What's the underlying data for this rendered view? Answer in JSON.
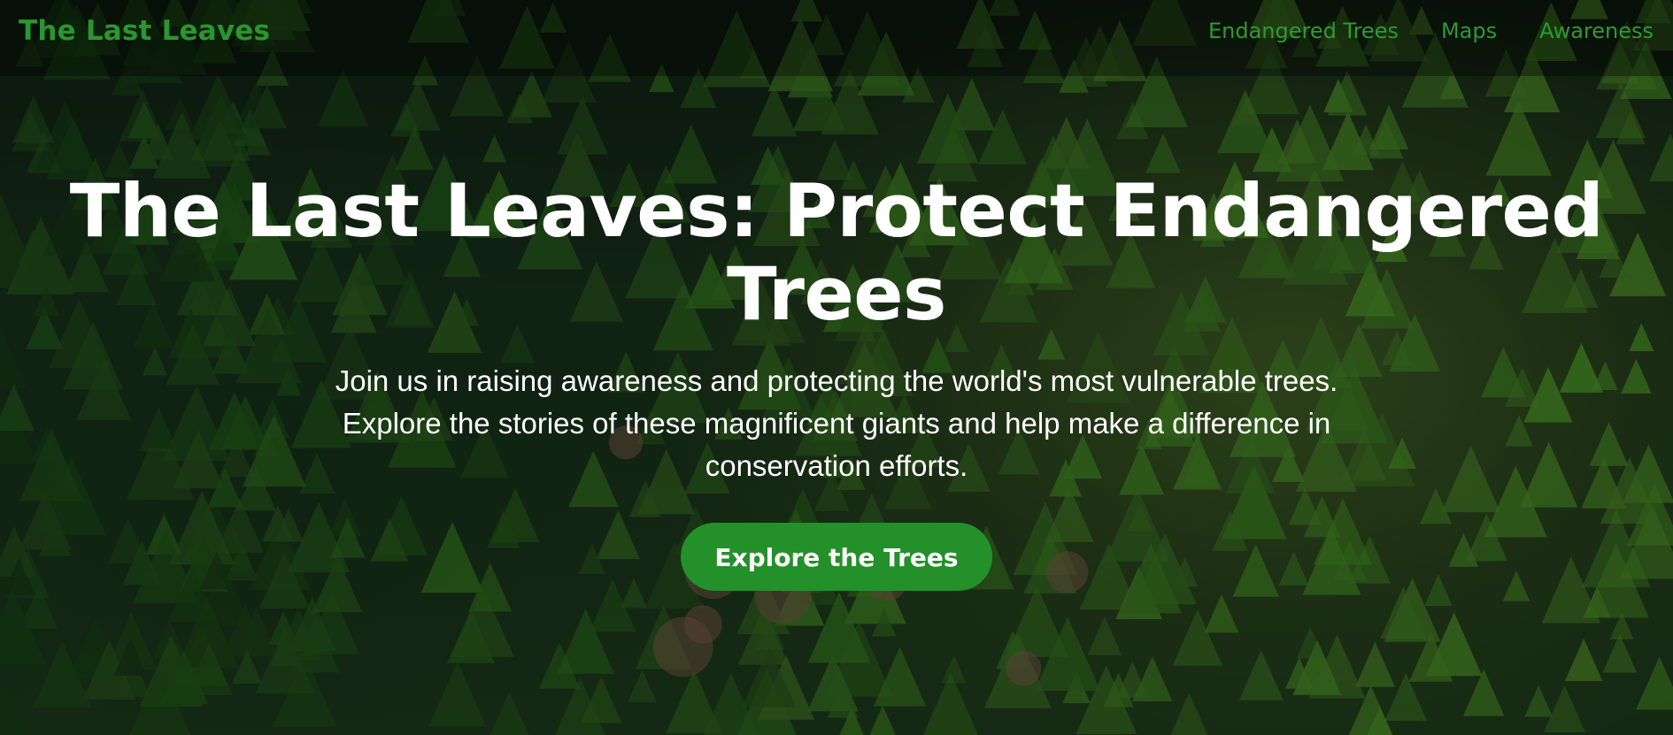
{
  "brand": {
    "name": "The Last Leaves"
  },
  "nav": {
    "items": [
      {
        "label": "Endangered Trees"
      },
      {
        "label": "Maps"
      },
      {
        "label": "Awareness"
      }
    ]
  },
  "hero": {
    "title": "The Last Leaves: Protect Endangered Trees",
    "subtitle": "Join us in raising awareness and protecting the world's most vulnerable trees. Explore the stories of these magnificent giants and help make a difference in conservation efforts.",
    "cta_label": "Explore the Trees"
  },
  "colors": {
    "brand_green": "#2a962f",
    "button_green": "#24902a",
    "text_white": "#ffffff"
  }
}
